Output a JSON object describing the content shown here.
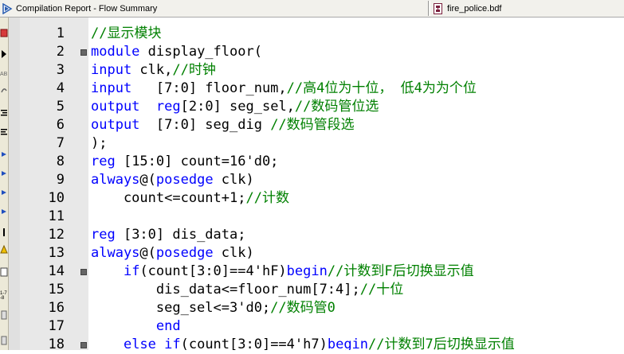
{
  "tabs": [
    {
      "label": "Compilation Report - Flow Summary",
      "icon": "compilation-report-icon"
    },
    {
      "label": "fire_police.bdf",
      "icon": "block-diagram-file-icon"
    }
  ],
  "editor": {
    "lines": [
      {
        "num": "1",
        "tokens": [
          {
            "t": "//显示模块",
            "c": "cm"
          }
        ]
      },
      {
        "num": "2",
        "tokens": [
          {
            "t": "module",
            "c": "kw"
          },
          {
            "t": " display_floor(",
            "c": "tx"
          }
        ]
      },
      {
        "num": "3",
        "tokens": [
          {
            "t": "input",
            "c": "kw"
          },
          {
            "t": " clk,",
            "c": "tx"
          },
          {
            "t": "//时钟",
            "c": "cm"
          }
        ]
      },
      {
        "num": "4",
        "tokens": [
          {
            "t": "input",
            "c": "kw"
          },
          {
            "t": "   [7:0] floor_num,",
            "c": "tx"
          },
          {
            "t": "//高4位为十位， 低4为为个位",
            "c": "cm"
          }
        ]
      },
      {
        "num": "5",
        "tokens": [
          {
            "t": "output",
            "c": "kw"
          },
          {
            "t": "  ",
            "c": "tx"
          },
          {
            "t": "reg",
            "c": "kw"
          },
          {
            "t": "[2:0] seg_sel,",
            "c": "tx"
          },
          {
            "t": "//数码管位选",
            "c": "cm"
          }
        ]
      },
      {
        "num": "6",
        "tokens": [
          {
            "t": "output",
            "c": "kw"
          },
          {
            "t": "  [7:0] seg_dig ",
            "c": "tx"
          },
          {
            "t": "//数码管段选",
            "c": "cm"
          }
        ]
      },
      {
        "num": "7",
        "tokens": [
          {
            "t": ");",
            "c": "tx"
          }
        ]
      },
      {
        "num": "8",
        "tokens": [
          {
            "t": "reg",
            "c": "kw"
          },
          {
            "t": " [15:0] count=16'd0;",
            "c": "tx"
          }
        ]
      },
      {
        "num": "9",
        "tokens": [
          {
            "t": "always",
            "c": "kw"
          },
          {
            "t": "@(",
            "c": "tx"
          },
          {
            "t": "posedge",
            "c": "kw"
          },
          {
            "t": " clk)",
            "c": "tx"
          }
        ]
      },
      {
        "num": "10",
        "tokens": [
          {
            "t": "    count<=count+1;",
            "c": "tx"
          },
          {
            "t": "//计数",
            "c": "cm"
          }
        ]
      },
      {
        "num": "11",
        "tokens": []
      },
      {
        "num": "12",
        "tokens": [
          {
            "t": "reg",
            "c": "kw"
          },
          {
            "t": " [3:0] dis_data;",
            "c": "tx"
          }
        ]
      },
      {
        "num": "13",
        "tokens": [
          {
            "t": "always",
            "c": "kw"
          },
          {
            "t": "@(",
            "c": "tx"
          },
          {
            "t": "posedge",
            "c": "kw"
          },
          {
            "t": " clk)",
            "c": "tx"
          }
        ]
      },
      {
        "num": "14",
        "tokens": [
          {
            "t": "    ",
            "c": "tx"
          },
          {
            "t": "if",
            "c": "kw"
          },
          {
            "t": "(count[3:0]==4'hF)",
            "c": "tx"
          },
          {
            "t": "begin",
            "c": "kw"
          },
          {
            "t": "//计数到F后切换显示值",
            "c": "cm"
          }
        ]
      },
      {
        "num": "15",
        "tokens": [
          {
            "t": "        dis_data<=floor_num[7:4];",
            "c": "tx"
          },
          {
            "t": "//十位",
            "c": "cm"
          }
        ]
      },
      {
        "num": "16",
        "tokens": [
          {
            "t": "        seg_sel<=3'd0;",
            "c": "tx"
          },
          {
            "t": "//数码管0",
            "c": "cm"
          }
        ]
      },
      {
        "num": "17",
        "tokens": [
          {
            "t": "        ",
            "c": "tx"
          },
          {
            "t": "end",
            "c": "kw"
          }
        ]
      },
      {
        "num": "18",
        "tokens": [
          {
            "t": "    ",
            "c": "tx"
          },
          {
            "t": "else if",
            "c": "kw"
          },
          {
            "t": "(count[3:0]==4'h7)",
            "c": "tx"
          },
          {
            "t": "begin",
            "c": "kw"
          },
          {
            "t": "//计数到7后切换显示值",
            "c": "cm"
          }
        ]
      }
    ],
    "fold_lines": [
      "2",
      "14",
      "18"
    ]
  },
  "colors": {
    "keyword": "#0000ff",
    "comment": "#008000",
    "text": "#000000",
    "gutter": "#e8e8e8"
  }
}
